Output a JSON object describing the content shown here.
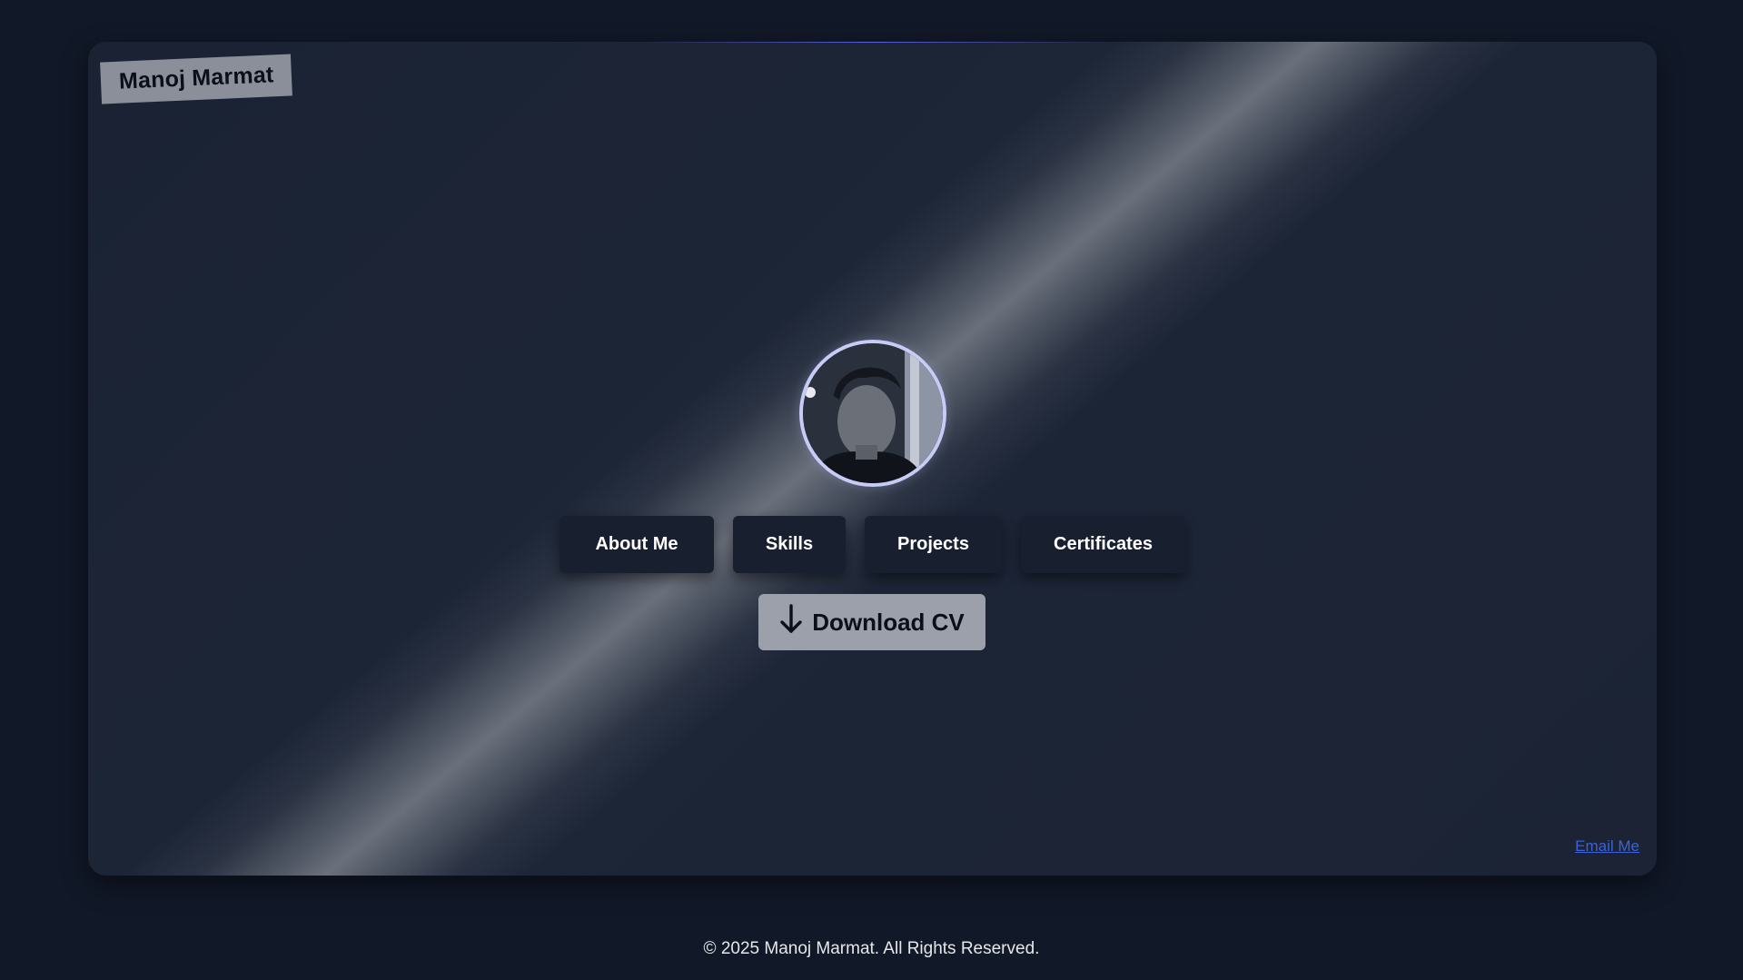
{
  "brand": {
    "name": "Manoj Marmat"
  },
  "profile": {
    "avatar_icon": "person-portrait"
  },
  "nav": {
    "items": [
      {
        "label": "About Me"
      },
      {
        "label": "Skills"
      },
      {
        "label": "Projects"
      },
      {
        "label": "Certificates"
      }
    ]
  },
  "cta": {
    "download_label": "Download CV",
    "download_icon": "arrow-down-icon"
  },
  "contact": {
    "email_label": "Email Me"
  },
  "footer": {
    "copyright": "© 2025 Manoj Marmat. All Rights Reserved."
  },
  "colors": {
    "page_bg": "#111827",
    "card_bg": "#1d2637",
    "brand_tag_bg": "#8a8f9a",
    "button_bg": "#182030",
    "download_bg": "#9ca0aa",
    "avatar_ring": "#c7cbf5",
    "link": "#3b62d8"
  }
}
